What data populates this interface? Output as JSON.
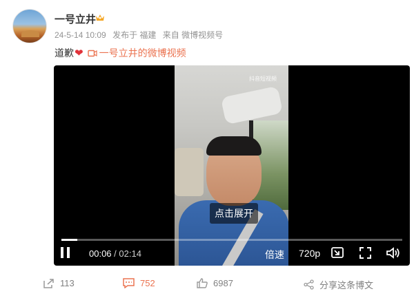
{
  "user": {
    "name": "一号立井",
    "avatar_icon": "avatar-image",
    "badge_icon": "crown-icon",
    "meta": {
      "date": "24-5-14 10:09",
      "location": "发布于 福建",
      "source": "来自 微博视频号"
    }
  },
  "post": {
    "text": "道歉",
    "emoji_icon": "heart-icon",
    "link_icon": "video-camera-icon",
    "video_link_text": "一号立井的微博视频"
  },
  "video": {
    "watermark": "抖音短视频",
    "expand_label": "点击展开",
    "progress": 0.046,
    "current_time": "00:06",
    "total_time": "02:14",
    "speed_label": "倍速",
    "quality_label": "720p",
    "icons": [
      "pause-icon",
      "picture-in-picture-icon",
      "fullscreen-icon",
      "volume-icon"
    ]
  },
  "actions": {
    "repost_count": "113",
    "comment_count": "752",
    "like_count": "6987",
    "share_label": "分享这条博文"
  },
  "colors": {
    "accent": "#eb7350",
    "heart": "#e0323a",
    "meta_gray": "#939393"
  }
}
